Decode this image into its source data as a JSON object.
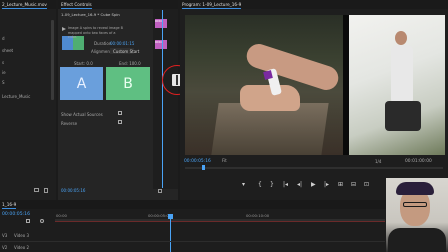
{
  "project_panel": {
    "tab": "2_Lecture_Music.mov",
    "items": [
      "d",
      "sheet",
      "s",
      "ie",
      "",
      "S",
      "Lecture_Music"
    ]
  },
  "effect_controls": {
    "tab": "Effect Controls",
    "clip_name": "1-09_Lecture_16-9 * Cube Spin",
    "description": "Image A spins to reveal image B mapped onto two faces of a cube.",
    "duration_label": "Duration",
    "duration_value": "00:00:01:15",
    "alignment_label": "Alignment",
    "alignment_value": "Custom Start",
    "start_label": "Start: 0.0",
    "end_label": "End: 100.0",
    "a_label": "A",
    "b_label": "B",
    "show_actual_sources": "Show Actual Sources",
    "reverse": "Reverse",
    "timecode": "00:00:05:16",
    "mini_clip_label_1": "RDN",
    "mini_clip_label_2": "RDN"
  },
  "program_monitor": {
    "tab": "Program: 1-09_Lecture_16-9",
    "timecode_left": "00:00:05:16",
    "fit": "Fit",
    "scale": "1/4",
    "timecode_right": "00:01:00:00",
    "controls": [
      "▾",
      "{",
      "|◂",
      "◂|",
      "▶",
      "|▸",
      "}",
      "⊞",
      "⊟",
      "⌶",
      "⊡"
    ]
  },
  "timeline": {
    "tab": "1_16-9",
    "timecode": "00:00:05:16",
    "rulers": [
      "00:00",
      "00:00:05:00",
      "00:00:10:00"
    ],
    "tracks": [
      "V3",
      "Video 3",
      "V2",
      "Video 2"
    ]
  },
  "colors": {
    "accent": "#3b8ee0",
    "effect_clip": "#c060c0",
    "clip_a": "#6a9fdc",
    "clip_b": "#5fbf82",
    "playhead": "#4aa3f5",
    "highlight_circle": "#e02020"
  }
}
